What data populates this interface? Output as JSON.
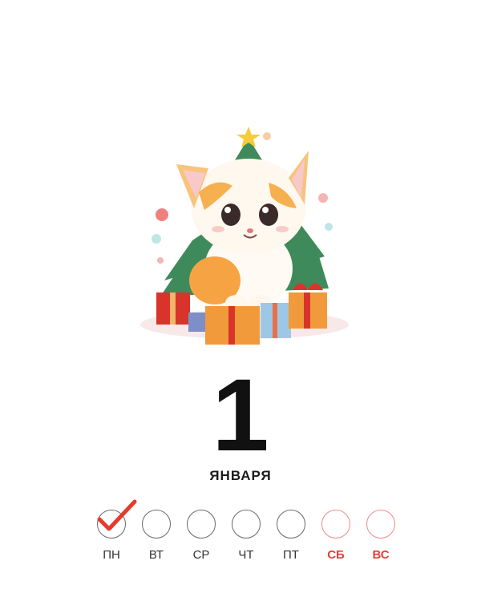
{
  "calendar": {
    "day": "1",
    "month": "ЯНВАРЯ",
    "weekdays": [
      {
        "label": "ПН",
        "checked": true,
        "weekend": false
      },
      {
        "label": "ВТ",
        "checked": false,
        "weekend": false
      },
      {
        "label": "СР",
        "checked": false,
        "weekend": false
      },
      {
        "label": "ЧТ",
        "checked": false,
        "weekend": false
      },
      {
        "label": "ПТ",
        "checked": false,
        "weekend": false
      },
      {
        "label": "СБ",
        "checked": false,
        "weekend": true
      },
      {
        "label": "ВС",
        "checked": false,
        "weekend": true
      }
    ],
    "checkmark_color": "#e53b2c",
    "weekend_color": "#e5403b"
  },
  "illustration": {
    "subject": "kitten-with-christmas-tree-and-gifts"
  }
}
